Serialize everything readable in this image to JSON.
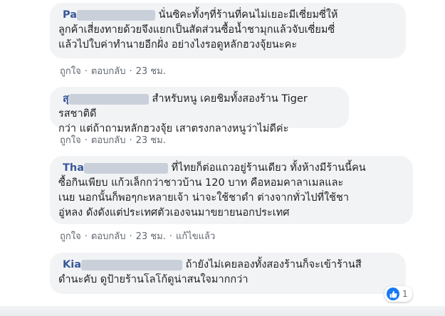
{
  "comments": [
    {
      "author": "Pa",
      "text_lines": [
        "นั่นซิคะทั้งๆที่ร้านที่คนไม่เยอะมีเซี่ยมซี่ให้",
        "ลูกค้าเสี่ยงทายด้วยจึงแยกเป็นสัดส่วนซื้อน้ำชามุกแล้วจับเซี่ยมซี่",
        "แล้วไปใบค่าทำนายอีกฝั่ง อย่างไงรอดูหลักฮวงจุ้ยนะคะ"
      ],
      "actions": {
        "like": "ถูกใจ",
        "reply": "ตอบกลับ",
        "time": "23 ชม."
      }
    },
    {
      "author": "สุ",
      "text_lines": [
        "สำหรับหนู เคยชิมทั้งสองร้าน Tiger รสชาติดี",
        "กว่า แต่ถ้าถามหลักฮวงจุ้ย เสาตรงกลางหนูว่าไม่ดีค่ะ"
      ],
      "actions": {
        "like": "ถูกใจ",
        "reply": "ตอบกลับ",
        "time": "23 ชม."
      }
    },
    {
      "author": "Tha",
      "text_lines": [
        "ที่ไทยก็ต่อแถวอยู่ร้านเดียว ทั้งห้างมีร้านนี้คน",
        "ซื้อกินเพียบ แก้วเล็กกว่าชาวบ้าน 120 บาท คือหอมคาลาเมลและ",
        "เนย นอกนั้นก็พอๆกะหลายเจ้า น่าจะใช้ชาดำ ต่างจากทั่วไปที่ใช้ชา",
        "อู่หลง ดังดังแต่ประเทศตัวเองจนมาขยายนอกประเทศ"
      ],
      "actions": {
        "like": "ถูกใจ",
        "reply": "ตอบกลับ",
        "time": "23 ชม.",
        "edited": "แก้ไขแล้ว"
      }
    },
    {
      "author": "Kia",
      "text_lines": [
        "ถ้ายังไม่เคยลองทั้งสองร้านก็จะเข้าร้านสี",
        "ดำนะคับ ดูป้ายร้านโลโก้ดูน่าสนใจมากกว่า"
      ]
    }
  ],
  "reaction": {
    "icon": "like-icon",
    "count": "1"
  },
  "colors": {
    "bubble": "#f2f3f5",
    "author": "#385898",
    "meta": "#606770",
    "like": "#1877f2"
  }
}
